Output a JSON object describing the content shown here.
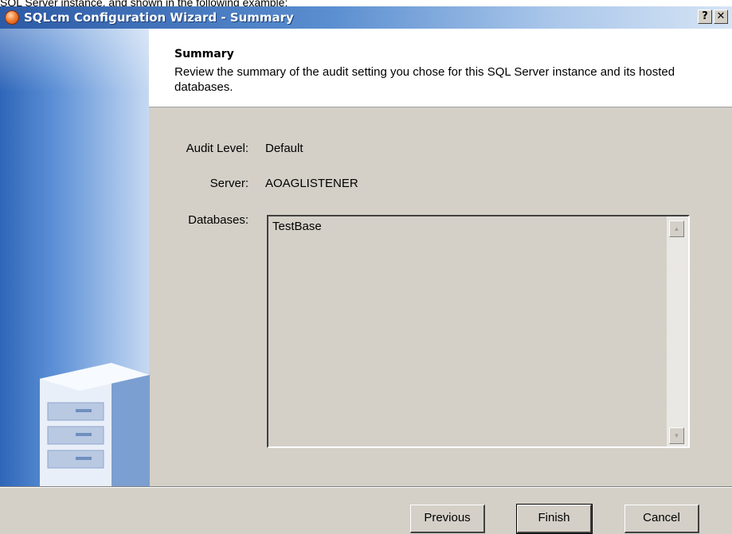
{
  "document": {
    "caption": "SQL Server instance, and shown in the following example:"
  },
  "window": {
    "title": "SQLcm Configuration Wizard - Summary",
    "help_label": "?",
    "close_label": "✕"
  },
  "header": {
    "title": "Summary",
    "description": "Review the summary of the audit setting you chose for this SQL Server instance and its hosted databases."
  },
  "summary": {
    "audit_level_label": "Audit Level:",
    "audit_level_value": "Default",
    "server_label": "Server:",
    "server_value": "AOAGLISTENER",
    "databases_label": "Databases:",
    "databases": [
      "TestBase"
    ]
  },
  "footer": {
    "previous_label": "Previous",
    "finish_label": "Finish",
    "cancel_label": "Cancel"
  },
  "icons": {
    "scroll_up": "up-arrow-icon",
    "scroll_down": "down-arrow-icon",
    "app": "sqlcm-app-icon",
    "server": "server-tower-icon"
  },
  "colors": {
    "title_bar": "#2c5aa6",
    "dialog_face": "#d4d0c8",
    "side_panel": "#5a8ed5"
  }
}
